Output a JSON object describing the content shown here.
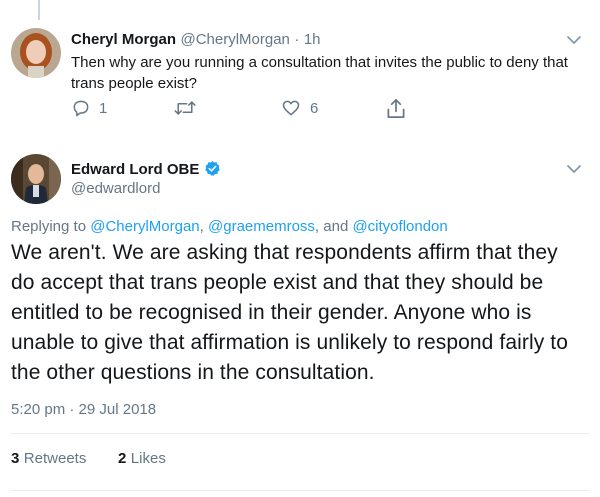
{
  "reply_tweet": {
    "name": "Cheryl Morgan",
    "handle": "@CherylMorgan",
    "separator": "·",
    "time": "1h",
    "text": "Then why are you running a consultation that invites the public to deny that trans people exist?",
    "actions": {
      "reply_count": "1",
      "retweet_count": "",
      "like_count": "6"
    }
  },
  "main_tweet": {
    "name": "Edward Lord OBE",
    "handle": "@edwardlord",
    "replying_to_prefix": "Replying to",
    "replying_to_users": [
      {
        "handle": "@CherylMorgan",
        "after": ", "
      },
      {
        "handle": "@graememross",
        "after": ", and "
      },
      {
        "handle": "@cityoflondon",
        "after": ""
      }
    ],
    "text_lines": [
      "We aren't. We are asking that respondents affirm that they",
      "do accept that trans people exist and that they should be",
      "entitled to be recognised in their gender. Anyone who is",
      "unable to give that affirmation is unlikely to respond fairly to",
      "the other questions in the consultation."
    ],
    "timestamp": "5:20 pm · 29 Jul 2018",
    "retweets_count": "3",
    "retweets_label": "Retweets",
    "likes_count": "2",
    "likes_label": "Likes"
  },
  "colors": {
    "link": "#1da1f2",
    "secondary_text": "#657786",
    "primary_text": "#14171a",
    "divider": "#e6ecf0"
  }
}
